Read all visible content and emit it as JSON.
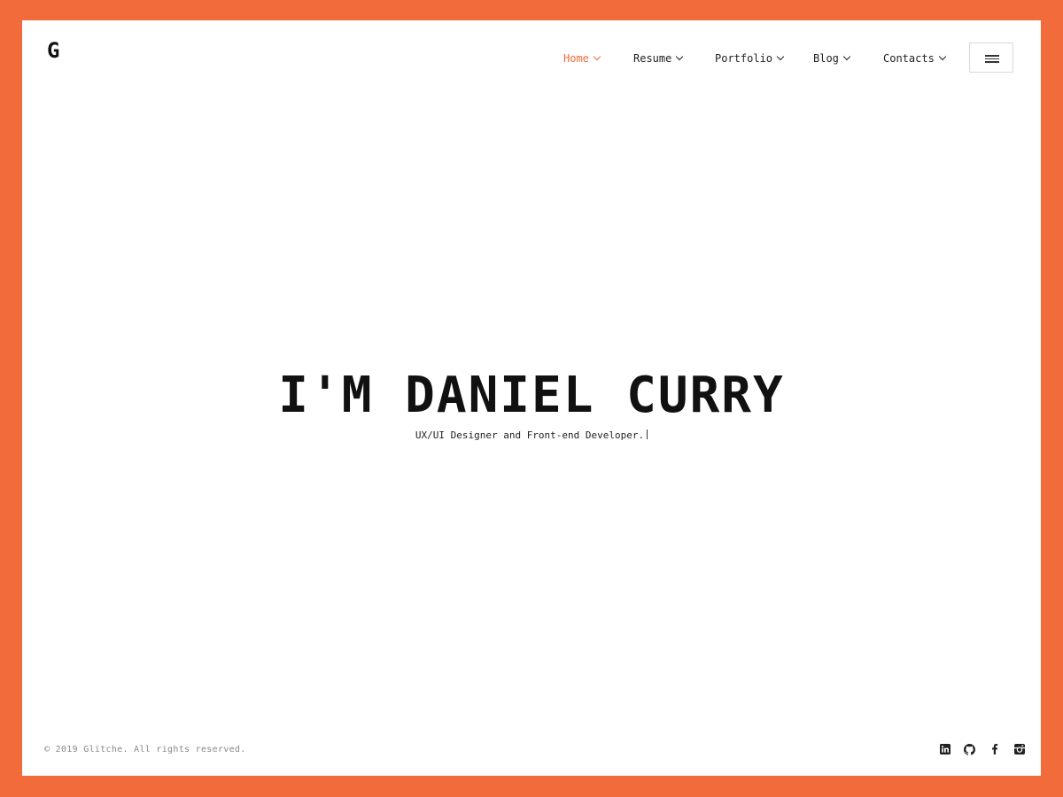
{
  "brand": {
    "logo": "G",
    "accent_color": "#f26b3a"
  },
  "nav": {
    "items": [
      {
        "label": "Home",
        "active": true
      },
      {
        "label": "Resume",
        "active": false
      },
      {
        "label": "Portfolio",
        "active": false
      },
      {
        "label": "Blog",
        "active": false
      },
      {
        "label": "Contacts",
        "active": false
      }
    ],
    "menu_icon": "hamburger-icon"
  },
  "hero": {
    "title": "I'M DANIEL CURRY",
    "subtitle": "UX/UI Designer and Front-end Developer."
  },
  "footer": {
    "copyright": "© 2019 Glitche. All rights reserved.",
    "socials": [
      "linkedin-icon",
      "github-icon",
      "facebook-icon",
      "instagram-icon"
    ]
  }
}
